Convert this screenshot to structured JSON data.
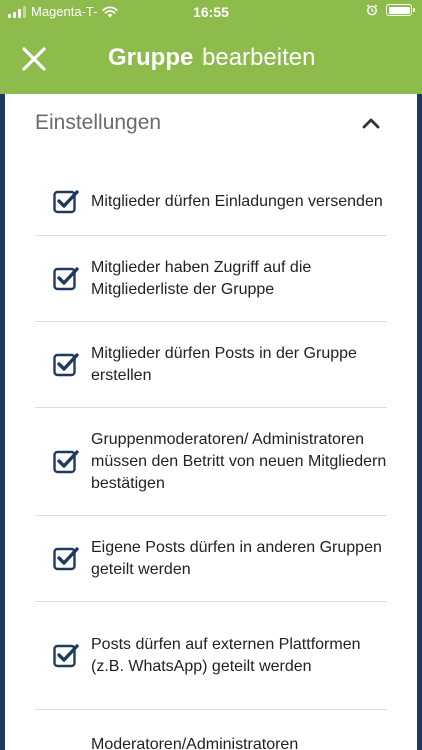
{
  "status_bar": {
    "carrier": "Magenta-T-",
    "time": "16:55"
  },
  "app_bar": {
    "title_bold": "Gruppe",
    "title_rest": "bearbeiten",
    "close_icon": "close-icon"
  },
  "colors": {
    "accent_green": "#8dbb4c",
    "frame_navy": "#1f3a5e",
    "checkbox_navy": "#1f3a5e"
  },
  "section": {
    "title": "Einstellungen",
    "expanded": true
  },
  "options": [
    {
      "label": "Mitglieder dürfen Einladungen versenden",
      "checked": true
    },
    {
      "label": "Mitglieder haben Zugriff auf die Mitgliederliste der Gruppe",
      "checked": true
    },
    {
      "label": "Mitglieder dürfen Posts in der Gruppe erstellen",
      "checked": true
    },
    {
      "label": "Gruppenmoderatoren/ Administratoren müssen den Betritt von neuen Mitgliedern bestätigen",
      "checked": true
    },
    {
      "label": "Eigene Posts dürfen in anderen Gruppen geteilt werden",
      "checked": true
    },
    {
      "label": "Posts dürfen auf externen Plattformen (z.B. WhatsApp) geteilt werden",
      "checked": true
    },
    {
      "label": "Moderatoren/Administratoren",
      "checked": true
    }
  ]
}
